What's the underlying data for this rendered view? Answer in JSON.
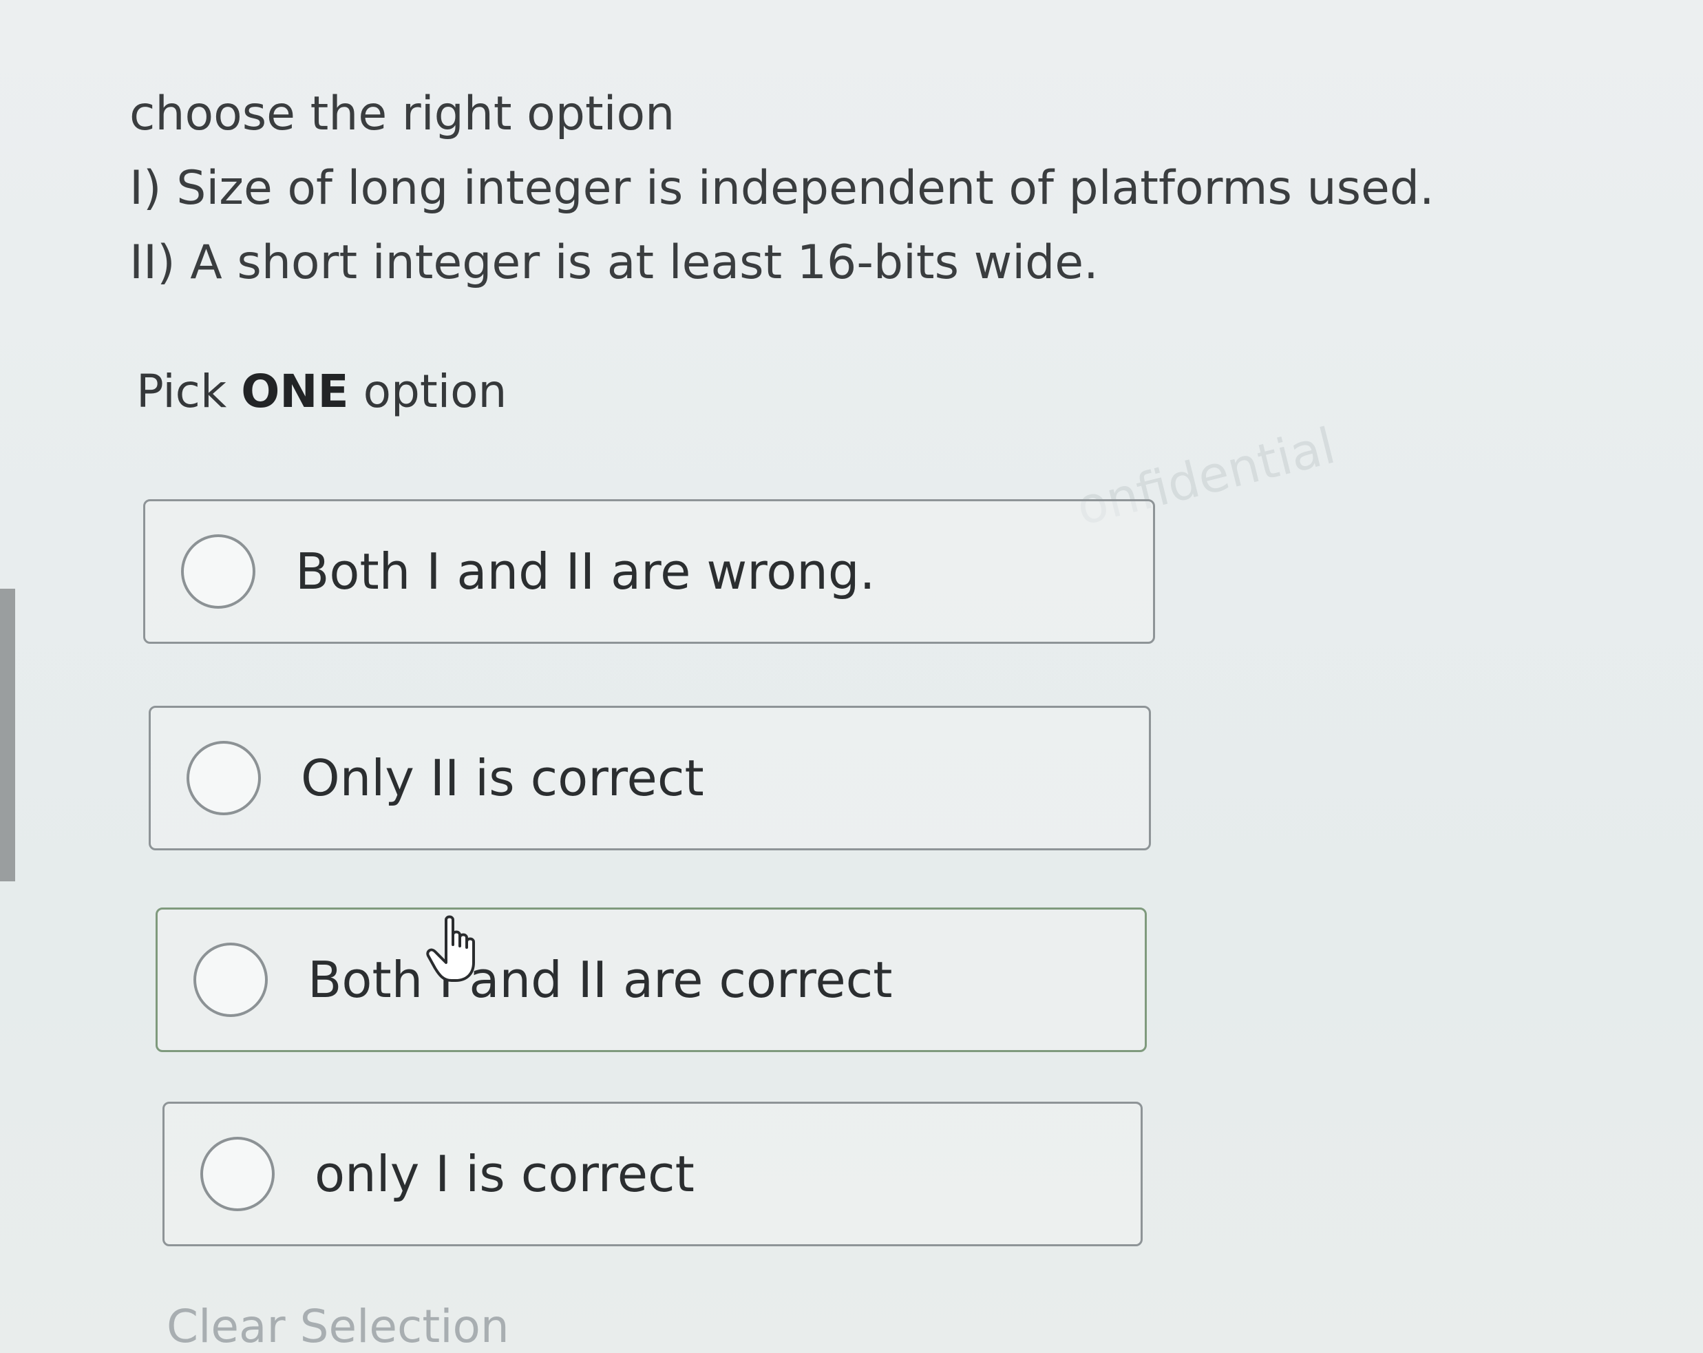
{
  "question": {
    "lines": [
      "choose the right option",
      "I) Size of long integer is independent of platforms used.",
      "II) A short integer is at least 16-bits wide."
    ]
  },
  "instruction": {
    "prefix": "Pick ",
    "emphasis": "ONE",
    "suffix": " option"
  },
  "options": [
    {
      "label": "Both I and II are wrong.",
      "selected": false
    },
    {
      "label": "Only II is correct",
      "selected": false
    },
    {
      "label": "Both I and II are correct",
      "selected": false
    },
    {
      "label": "only I is correct",
      "selected": false
    }
  ],
  "watermark": "onfidential",
  "clear_selection": "Clear Selection",
  "icons": {
    "radio": "radio-unchecked-icon",
    "cursor": "hand-pointer-icon"
  },
  "colors": {
    "text": "#3a3d3f",
    "border": "#8e9497",
    "muted": "#a8aeb1"
  }
}
